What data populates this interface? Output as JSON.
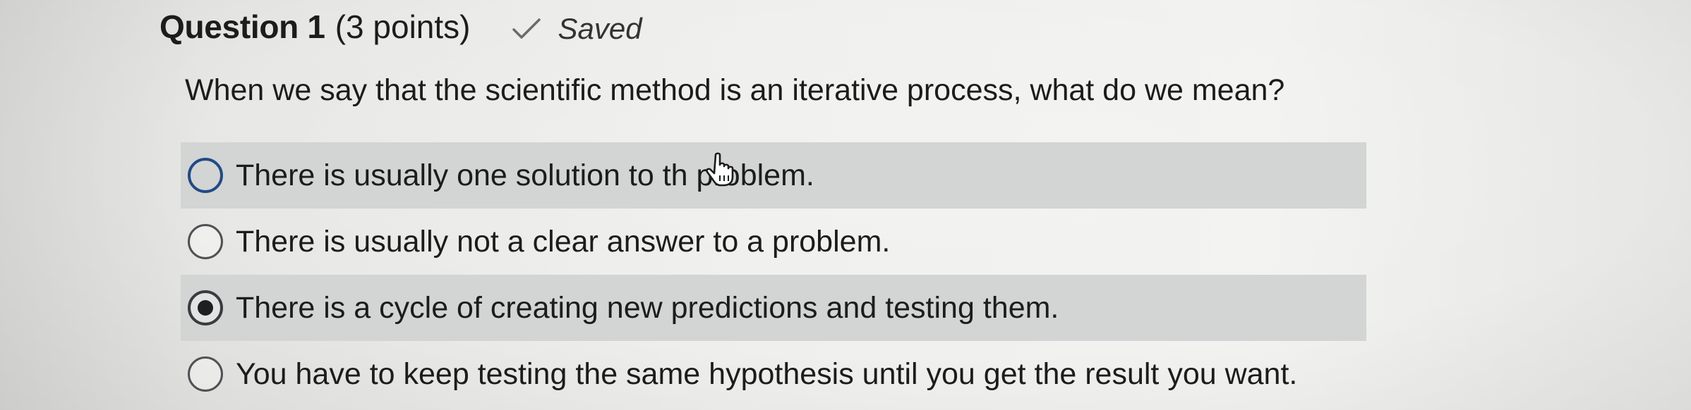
{
  "question": {
    "title": "Question 1",
    "points": "(3 points)",
    "saved_label": "Saved",
    "prompt": "When we say that the scientific method is an iterative process, what do we mean?"
  },
  "answers": [
    {
      "text": "There is usually one solution to th",
      "text_after_cursor": " problem.",
      "selected": false
    },
    {
      "text": "There is usually not a clear answer to a problem.",
      "selected": false
    },
    {
      "text": "There is a cycle of creating new predictions and testing them.",
      "selected": true
    },
    {
      "text": "You have to keep testing the same hypothesis until you get the result you want.",
      "selected": false
    }
  ],
  "icons": {
    "saved": "checkmark-icon",
    "cursor": "hand-pointer-icon"
  },
  "colors": {
    "highlight_row": "#d3d4d4",
    "focus_radio": "#214a86"
  }
}
